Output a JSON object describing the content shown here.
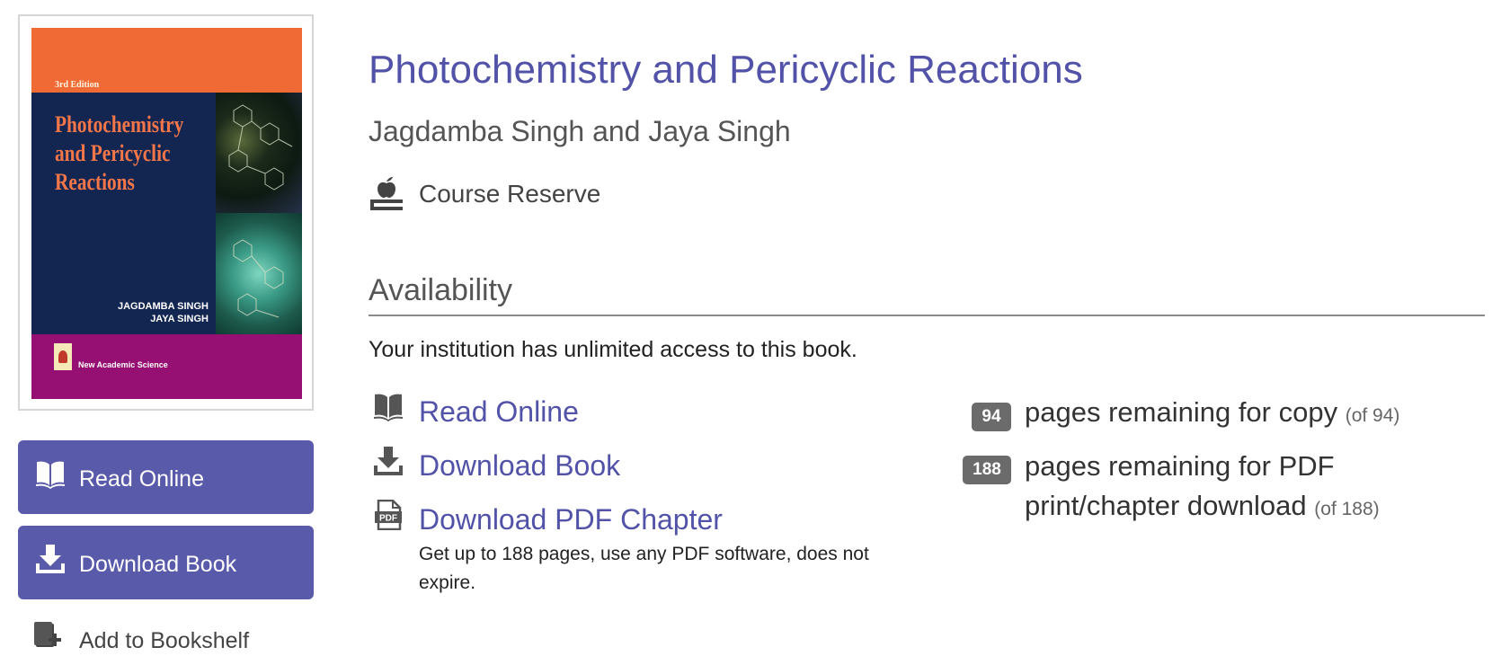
{
  "cover": {
    "edition": "3rd Edition",
    "title_lines": [
      "Photochemistry",
      "and Pericyclic",
      "Reactions"
    ],
    "author_lines": [
      "JAGDAMBA SINGH",
      "JAYA SINGH"
    ],
    "publisher": "New Academic Science"
  },
  "sidebar": {
    "read_online_label": "Read Online",
    "download_book_label": "Download Book",
    "add_to_bookshelf_label": "Add to Bookshelf"
  },
  "book": {
    "title": "Photochemistry and Pericyclic Reactions",
    "authors": "Jagdamba Singh and Jaya Singh",
    "course_reserve_label": "Course Reserve"
  },
  "availability": {
    "heading": "Availability",
    "access_text": "Your institution has unlimited access to this book.",
    "actions": {
      "read_online": "Read Online",
      "download_book": "Download Book",
      "download_pdf_chapter": "Download PDF Chapter"
    },
    "pdf_note": "Get up to 188 pages, use any PDF software, does not expire.",
    "copy": {
      "count": "94",
      "text": "pages remaining for copy",
      "of": "(of 94)"
    },
    "print": {
      "count": "188",
      "text": "pages remaining for PDF print/chapter download",
      "of": "(of 188)"
    }
  },
  "icons": {
    "read_online": "open-book-icon",
    "download_book": "download-icon",
    "add_to_bookshelf": "add-bookshelf-icon",
    "course_reserve": "apple-on-book-icon",
    "download_pdf": "pdf-file-icon"
  },
  "colors": {
    "accent": "#5152a8",
    "button_bg": "#5a5aaa",
    "badge_bg": "#6b6b6b",
    "rule": "#8a8a8a"
  }
}
